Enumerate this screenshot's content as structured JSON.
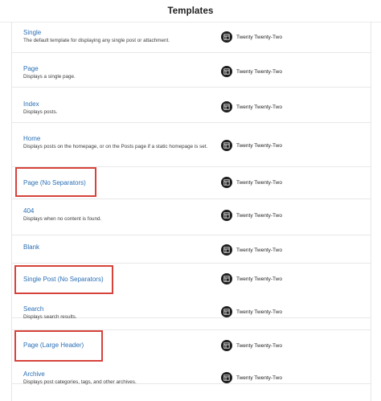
{
  "header": {
    "title": "Templates"
  },
  "templates": [
    {
      "name": "Single",
      "description": "The default template for displaying any single post or attachment.",
      "theme": "Twenty Twenty-Two",
      "theme_icon": "layout-icon"
    },
    {
      "name": "Page",
      "description": "Displays a single page.",
      "theme": "Twenty Twenty-Two",
      "theme_icon": "layout-icon"
    },
    {
      "name": "Index",
      "description": "Displays posts.",
      "theme": "Twenty Twenty-Two",
      "theme_icon": "layout-icon"
    },
    {
      "name": "Home",
      "description": "Displays posts on the homepage, or on the Posts page if a static homepage is set.",
      "theme": "Twenty Twenty-Two",
      "theme_icon": "layout-icon"
    },
    {
      "name": "Page (No Separators)",
      "description": "",
      "theme": "Twenty Twenty-Two",
      "theme_icon": "layout-icon",
      "highlighted": true
    },
    {
      "name": "404",
      "description": "Displays when no content is found.",
      "theme": "Twenty Twenty-Two",
      "theme_icon": "layout-icon"
    },
    {
      "name": "Blank",
      "description": "",
      "theme": "Twenty Twenty-Two",
      "theme_icon": "layout-icon"
    },
    {
      "name": "Single Post (No Separators)",
      "description": "",
      "theme": "Twenty Twenty-Two",
      "theme_icon": "layout-icon",
      "highlighted": true
    },
    {
      "name": "Search",
      "description": "Displays search results.",
      "theme": "Twenty Twenty-Two",
      "theme_icon": "layout-icon"
    },
    {
      "name": "Page (Large Header)",
      "description": "",
      "theme": "Twenty Twenty-Two",
      "theme_icon": "layout-icon",
      "highlighted": true
    },
    {
      "name": "Archive",
      "description": "Displays post categories, tags, and other archives.",
      "theme": "Twenty Twenty-Two",
      "theme_icon": "layout-icon"
    }
  ],
  "colors": {
    "link": "#2a6fb5",
    "highlight_border": "#d6433b",
    "icon_bg": "#1e1e1e"
  }
}
